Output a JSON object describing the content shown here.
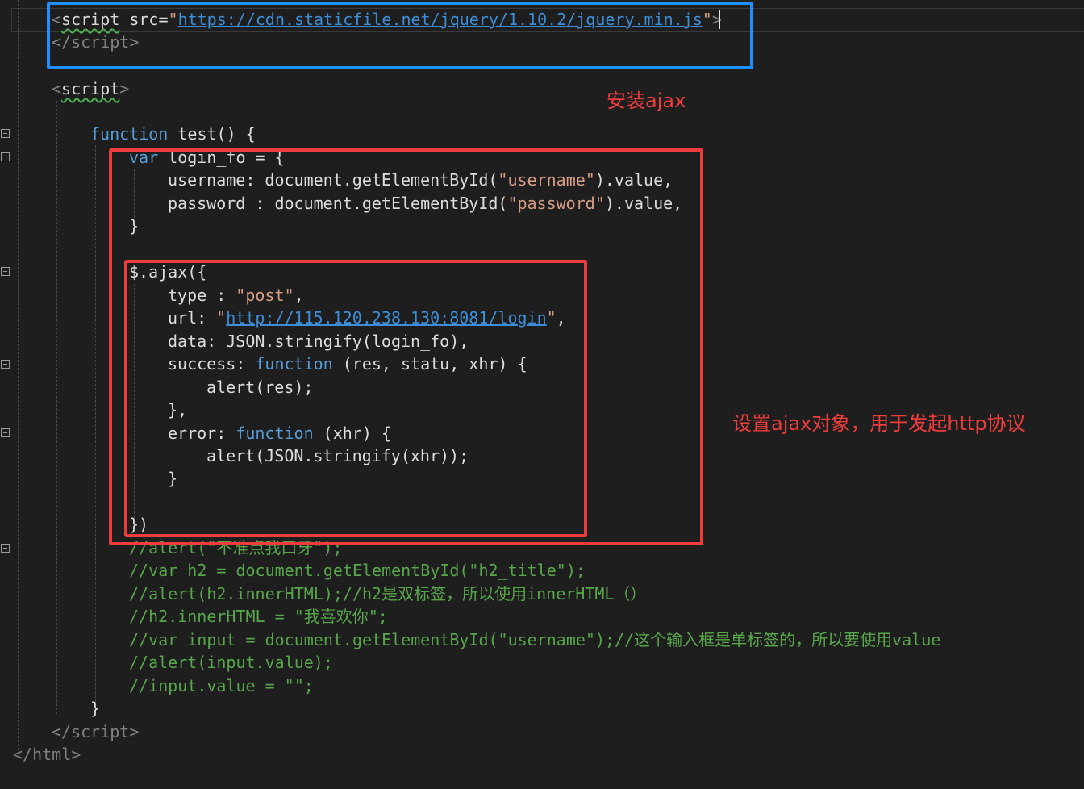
{
  "code": {
    "l0_open": "<",
    "l0_tag": "script",
    "l0_attr": " src=",
    "l0_q1": "\"",
    "l0_url": "https://cdn.staticfile.net/jquery/1.10.2/jquery.min.js",
    "l0_q2": "\"",
    "l0_close": ">",
    "l1_open": "</",
    "l1_tag": "script",
    "l1_close": ">",
    "l2_open": "<",
    "l2_tag": "script",
    "l2_close": ">",
    "fn_kw": "function",
    "fn_name": " test() {",
    "var_kw": "var",
    "var_rest": " login_fo = {",
    "user_key": "username",
    "user_mid": ": document.getElementById(",
    "user_str": "\"username\"",
    "user_end": ").value,",
    "pass_key": "password",
    "pass_mid": " : document.getElementById(",
    "pass_str": "\"password\"",
    "pass_end": ").value,",
    "close_brace": "}",
    "ajax": "$.ajax({",
    "type_key": "type",
    "type_mid": " : ",
    "type_str": "\"post\"",
    "type_end": ",",
    "url_key": "url",
    "url_mid": ": ",
    "url_q1": "\"",
    "url_link": "http://115.120.238.130:8081/login",
    "url_q2": "\"",
    "url_end": ",",
    "data_key": "data",
    "data_rest": ": JSON.stringify(login_fo),",
    "succ_key": "success",
    "succ_mid": ": ",
    "succ_fn": "function",
    "succ_args": " (res, statu, xhr) {",
    "alert_res": "alert(res);",
    "close_comma": "},",
    "err_key": "error",
    "err_mid": ": ",
    "err_fn": "function",
    "err_args": " (xhr) {",
    "alert_xhr": "alert(JSON.stringify(xhr));",
    "close_inner": "}",
    "ajax_close": "})",
    "c1": "//alert(\"不准点我口牙\");",
    "c2": "//var h2 = document.getElementById(\"h2_title\");",
    "c3": "//alert(h2.innerHTML);//h2是双标签，所以使用innerHTML（）",
    "c4": "//h2.innerHTML = \"我喜欢你\";",
    "c5": "//var input = document.getElementById(\"username\");//这个输入框是单标签的，所以要使用value",
    "c6": "//alert(input.value);",
    "c7": "//input.value = \"\";",
    "fn_close": "}",
    "end_open": "</",
    "end_tag": "script",
    "end_close": ">",
    "html_open": "</",
    "html_tag": "html",
    "html_close": ">"
  },
  "annotations": {
    "install_ajax": "安装ajax",
    "set_ajax": "设置ajax对象，用于发起http协议"
  },
  "colors": {
    "keyword": "#569cd6",
    "string": "#d69d85",
    "comment": "#57a64a",
    "link": "#3c8ed8",
    "blue_box": "#1e90ff",
    "red_box": "#f03c3c",
    "background": "#1e1e1e"
  }
}
